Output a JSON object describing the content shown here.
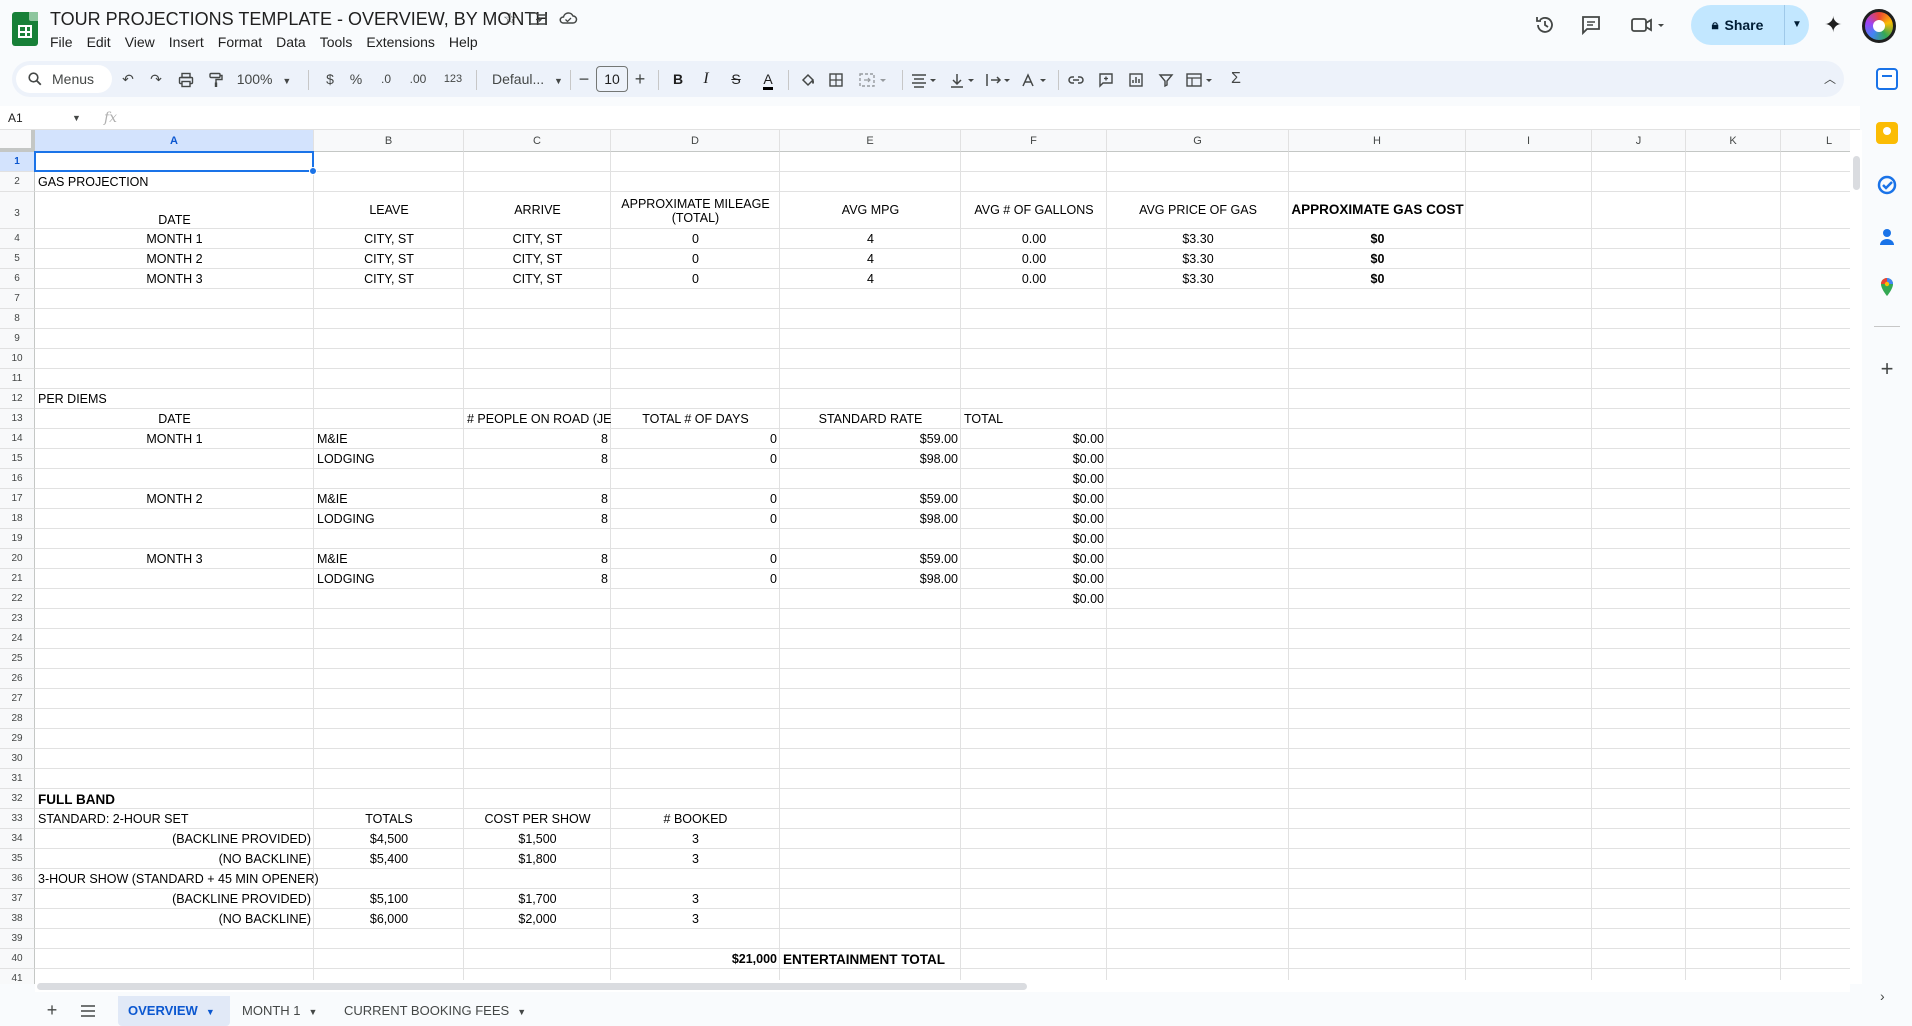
{
  "title_bar": {
    "doc_title": "TOUR PROJECTIONS TEMPLATE - OVERVIEW, BY MONTH",
    "menu": [
      "File",
      "Edit",
      "View",
      "Insert",
      "Format",
      "Data",
      "Tools",
      "Extensions",
      "Help"
    ],
    "share_label": "Share"
  },
  "toolbar": {
    "menus_label": "Menus",
    "zoom": "100%",
    "currency": "$",
    "percent": "%",
    "dec_dec": ".0",
    "dec_inc": ".00",
    "number_format": "123",
    "font": "Defaul...",
    "font_size": "10"
  },
  "formula_bar": {
    "cell_ref": "A1",
    "fx": "fx",
    "value": ""
  },
  "grid": {
    "columns": [
      "A",
      "B",
      "C",
      "D",
      "E",
      "F",
      "G",
      "H",
      "I",
      "J",
      "K",
      "L"
    ],
    "selected_column": "A",
    "selected_row": 1,
    "row_count": 41,
    "cells": {
      "r2": {
        "A": "GAS PROJECTION"
      },
      "r3": {
        "A": "DATE",
        "B": "LEAVE",
        "C": "ARRIVE",
        "D": "APPROXIMATE MILEAGE (TOTAL)",
        "E": "AVG MPG",
        "F": "AVG # OF GALLONS",
        "G": "AVG PRICE OF GAS",
        "H": "APPROXIMATE GAS COST"
      },
      "r4": {
        "A": "MONTH 1",
        "B": "CITY, ST",
        "C": "CITY, ST",
        "D": "0",
        "E": "4",
        "F": "0.00",
        "G": "$3.30",
        "H": "$0"
      },
      "r5": {
        "A": "MONTH 2",
        "B": "CITY, ST",
        "C": "CITY, ST",
        "D": "0",
        "E": "4",
        "F": "0.00",
        "G": "$3.30",
        "H": "$0"
      },
      "r6": {
        "A": "MONTH 3",
        "B": "CITY, ST",
        "C": "CITY, ST",
        "D": "0",
        "E": "4",
        "F": "0.00",
        "G": "$3.30",
        "H": "$0"
      },
      "r12": {
        "A": "PER DIEMS"
      },
      "r13": {
        "A": "DATE",
        "C": "# PEOPLE ON ROAD (JE",
        "D": "TOTAL # OF DAYS",
        "E": "STANDARD RATE",
        "F": "TOTAL"
      },
      "r14": {
        "A": "MONTH 1",
        "B": "M&IE",
        "C": "8",
        "D": "0",
        "E": "$59.00",
        "F": "$0.00"
      },
      "r15": {
        "B": "LODGING",
        "C": "8",
        "D": "0",
        "E": "$98.00",
        "F": "$0.00"
      },
      "r16": {
        "F": "$0.00"
      },
      "r17": {
        "A": "MONTH 2",
        "B": "M&IE",
        "C": "8",
        "D": "0",
        "E": "$59.00",
        "F": "$0.00"
      },
      "r18": {
        "B": "LODGING",
        "C": "8",
        "D": "0",
        "E": "$98.00",
        "F": "$0.00"
      },
      "r19": {
        "F": "$0.00"
      },
      "r20": {
        "A": "MONTH 3",
        "B": "M&IE",
        "C": "8",
        "D": "0",
        "E": "$59.00",
        "F": "$0.00"
      },
      "r21": {
        "B": "LODGING",
        "C": "8",
        "D": "0",
        "E": "$98.00",
        "F": "$0.00"
      },
      "r22": {
        "F": "$0.00"
      },
      "r32": {
        "A": "FULL BAND"
      },
      "r33": {
        "A": "STANDARD: 2-HOUR SET",
        "B": "TOTALS",
        "C": "COST PER SHOW",
        "D": "# BOOKED"
      },
      "r34": {
        "A": "(BACKLINE PROVIDED)",
        "B": "$4,500",
        "C": "$1,500",
        "D": "3"
      },
      "r35": {
        "A": "(NO BACKLINE)",
        "B": "$5,400",
        "C": "$1,800",
        "D": "3"
      },
      "r36": {
        "A": "3-HOUR SHOW (STANDARD + 45 MIN OPENER)"
      },
      "r37": {
        "A": "(BACKLINE PROVIDED)",
        "B": "$5,100",
        "C": "$1,700",
        "D": "3"
      },
      "r38": {
        "A": "(NO BACKLINE)",
        "B": "$6,000",
        "C": "$2,000",
        "D": "3"
      },
      "r40": {
        "D": "$21,000",
        "E": "ENTERTAINMENT TOTAL"
      }
    }
  },
  "sheet_tabs": [
    "OVERVIEW",
    "MONTH 1",
    "CURRENT BOOKING FEES"
  ],
  "active_tab": "OVERVIEW",
  "colors": {
    "selection": "#1a73e8",
    "header_selected": "#d3e3fd",
    "share_bg": "#c2e7ff",
    "sheets_green": "#188038"
  }
}
